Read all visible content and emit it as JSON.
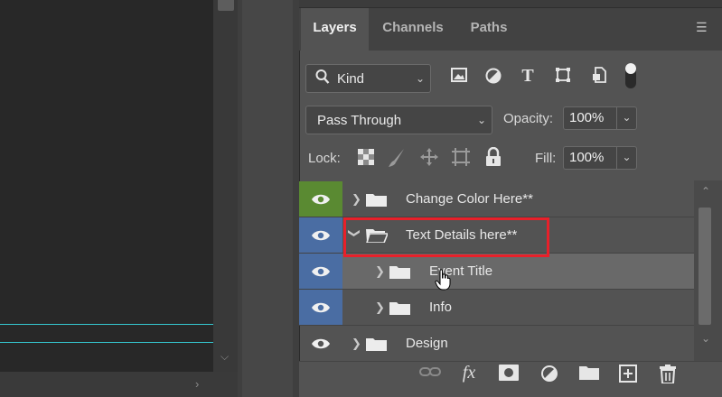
{
  "tabs": [
    {
      "label": "Layers",
      "active": true
    },
    {
      "label": "Channels",
      "active": false
    },
    {
      "label": "Paths",
      "active": false
    }
  ],
  "filter": {
    "label": "Kind"
  },
  "filter_icons": [
    "image-filter-icon",
    "adjustment-filter-icon",
    "type-filter-icon",
    "shape-filter-icon",
    "smart-object-filter-icon",
    "filter-toggle-icon"
  ],
  "blend_mode": "Pass Through",
  "opacity": {
    "label": "Opacity:",
    "value": "100%"
  },
  "lock": {
    "label": "Lock:",
    "icons": [
      "lock-transparent-icon",
      "lock-image-icon",
      "lock-position-icon",
      "lock-artboard-icon",
      "lock-all-icon"
    ]
  },
  "fill": {
    "label": "Fill:",
    "value": "100%"
  },
  "layers": [
    {
      "name": "Change Color Here**",
      "eye_color": "#5a8a32",
      "expanded": false,
      "indent": 0,
      "selected": false
    },
    {
      "name": "Text Details here**",
      "eye_color": "#4a6da3",
      "expanded": true,
      "indent": 0,
      "selected": false
    },
    {
      "name": "Event Title",
      "eye_color": "#4a6da3",
      "expanded": false,
      "indent": 1,
      "selected": true
    },
    {
      "name": "Info",
      "eye_color": "#4a6da3",
      "expanded": false,
      "indent": 1,
      "selected": false
    },
    {
      "name": "Design",
      "eye_color": "",
      "expanded": false,
      "indent": 0,
      "selected": false
    }
  ],
  "footer_icons": [
    "link-layers-icon",
    "fx-icon",
    "add-mask-icon",
    "adjustment-layer-icon",
    "new-group-icon",
    "new-layer-icon",
    "delete-layer-icon"
  ],
  "colors": {
    "highlight_box": "#e8202a",
    "guide_line": "#35c8d0",
    "selected_row": "#696969"
  }
}
